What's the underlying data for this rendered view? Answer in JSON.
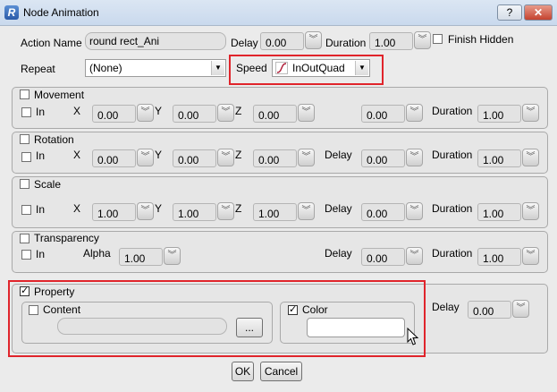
{
  "window": {
    "title": "Node Animation",
    "help_label": "?",
    "close_label": "✕"
  },
  "top": {
    "action_name_label": "Action Name",
    "action_name_value": "round rect_Ani",
    "delay_label": "Delay",
    "delay_value": "0.00",
    "duration_label": "Duration",
    "duration_value": "1.00",
    "finish_hidden_label": "Finish Hidden",
    "repeat_label": "Repeat",
    "repeat_value": "(None)",
    "speed_label": "Speed",
    "speed_value": "InOutQuad"
  },
  "movement": {
    "label": "Movement",
    "in_label": "In",
    "x_label": "X",
    "x": "0.00",
    "y_label": "Y",
    "y": "0.00",
    "z_label": "Z",
    "z": "0.00",
    "delay": "0.00",
    "duration_label": "Duration",
    "duration": "1.00"
  },
  "rotation": {
    "label": "Rotation",
    "in_label": "In",
    "x_label": "X",
    "x": "0.00",
    "y_label": "Y",
    "y": "0.00",
    "z_label": "Z",
    "z": "0.00",
    "delay_label": "Delay",
    "delay": "0.00",
    "duration_label": "Duration",
    "duration": "1.00"
  },
  "scale": {
    "label": "Scale",
    "in_label": "In",
    "x_label": "X",
    "x": "1.00",
    "y_label": "Y",
    "y": "1.00",
    "z_label": "Z",
    "z": "1.00",
    "delay_label": "Delay",
    "delay": "0.00",
    "duration_label": "Duration",
    "duration": "1.00"
  },
  "transparency": {
    "label": "Transparency",
    "in_label": "In",
    "alpha_label": "Alpha",
    "alpha": "1.00",
    "delay_label": "Delay",
    "delay": "0.00",
    "duration_label": "Duration",
    "duration": "1.00"
  },
  "property": {
    "label": "Property",
    "content_label": "Content",
    "browse_label": "...",
    "color_label": "Color",
    "delay_label": "Delay",
    "delay": "0.00"
  },
  "footer": {
    "ok_label": "OK",
    "cancel_label": "Cancel"
  },
  "colors": {
    "highlight": "#e0242b",
    "titlebar": "#c9d9ed",
    "close": "#c5432f"
  },
  "icons": {
    "spinner": "double-chevron-down-icon",
    "dropdown": "triangle-down-icon",
    "speed_curve": "ease-curve-icon"
  }
}
